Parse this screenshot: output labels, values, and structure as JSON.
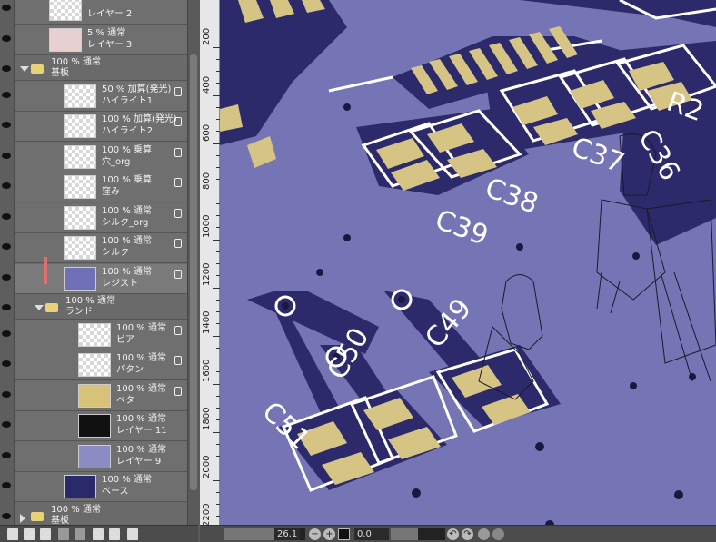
{
  "layers": [
    {
      "mode": "",
      "name": "レイヤー 2",
      "thumb": "plain",
      "indent": 0,
      "folder": false
    },
    {
      "mode": "5 % 通常",
      "name": "レイヤー 3",
      "thumb": "pink",
      "indent": 0,
      "folder": false
    },
    {
      "mode": "100 % 通常",
      "name": "基板",
      "indent": 0,
      "folder": true,
      "open": true
    },
    {
      "mode": "50 % 加算(発光)",
      "name": "ハイライト1",
      "thumb": "plain",
      "indent": 1,
      "folder": false,
      "lock": true
    },
    {
      "mode": "100 % 加算(発光)",
      "name": "ハイライト2",
      "thumb": "plain",
      "indent": 1,
      "folder": false,
      "lock": true
    },
    {
      "mode": "100 % 乗算",
      "name": "穴_org",
      "thumb": "plain",
      "indent": 1,
      "folder": false,
      "lock": true
    },
    {
      "mode": "100 % 乗算",
      "name": "窪み",
      "thumb": "plain",
      "indent": 1,
      "folder": false,
      "lock": true
    },
    {
      "mode": "100 % 通常",
      "name": "シルク_org",
      "thumb": "plain",
      "indent": 1,
      "folder": false,
      "lock": true
    },
    {
      "mode": "100 % 通常",
      "name": "シルク",
      "thumb": "plain",
      "indent": 1,
      "folder": false,
      "lock": true
    },
    {
      "mode": "100 % 通常",
      "name": "レジスト",
      "thumb": "blue",
      "indent": 1,
      "folder": false,
      "lock": true,
      "selected": true
    },
    {
      "mode": "100 % 通常",
      "name": "ランド",
      "indent": 1,
      "folder": true,
      "open": true
    },
    {
      "mode": "100 % 通常",
      "name": "ビア",
      "thumb": "plain",
      "indent": 2,
      "folder": false,
      "lock": true
    },
    {
      "mode": "100 % 通常",
      "name": "パタン",
      "thumb": "plain",
      "indent": 2,
      "folder": false,
      "lock": true
    },
    {
      "mode": "100 % 通常",
      "name": "ベタ",
      "thumb": "gold",
      "indent": 2,
      "folder": false,
      "lock": true
    },
    {
      "mode": "100 % 通常",
      "name": "レイヤー 11",
      "thumb": "dark",
      "indent": 2,
      "folder": false
    },
    {
      "mode": "100 % 通常",
      "name": "レイヤー 9",
      "thumb": "lavender",
      "indent": 2,
      "folder": false
    },
    {
      "mode": "100 % 通常",
      "name": "ベース",
      "thumb": "navy",
      "indent": 1,
      "folder": false
    },
    {
      "mode": "100 % 通常",
      "name": "基板",
      "indent": 0,
      "folder": true,
      "open": false
    }
  ],
  "ruler": {
    "labels": [
      "200",
      "400",
      "600",
      "800",
      "1000",
      "1200",
      "1400",
      "1600",
      "1800",
      "2000",
      "2200"
    ]
  },
  "silk_labels": [
    "C39",
    "C38",
    "C37",
    "C36",
    "R2",
    "C49",
    "C50",
    "C51"
  ],
  "status": {
    "zoom": "26.1",
    "angle": "0.0"
  },
  "colors": {
    "board": "#7575b5",
    "trace": "#2c2a6b",
    "pad": "#d6c485",
    "silk": "#ffffff"
  }
}
